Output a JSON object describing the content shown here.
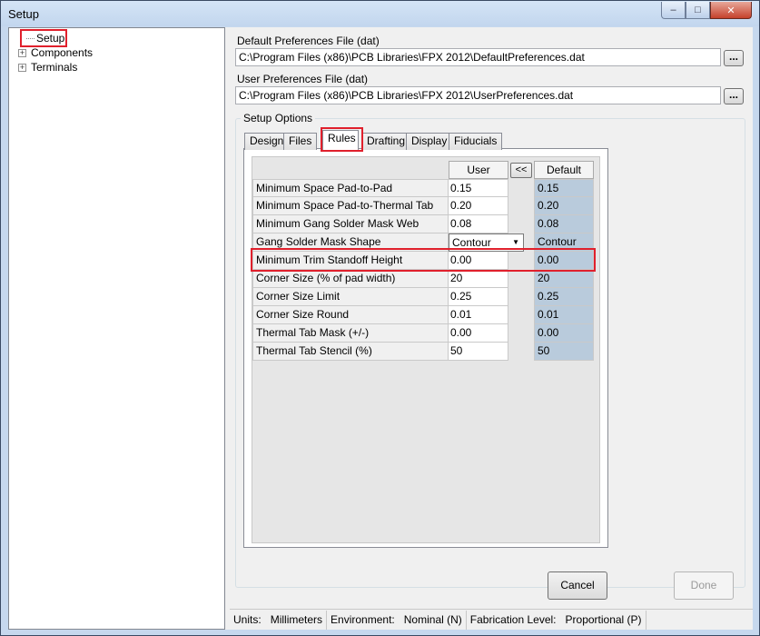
{
  "window": {
    "title": "Setup",
    "minimize": "–",
    "maximize": "□",
    "close": "✕"
  },
  "tree": {
    "items": [
      {
        "label": "Setup",
        "expander": ""
      },
      {
        "label": "Components",
        "expander": "+"
      },
      {
        "label": "Terminals",
        "expander": "+"
      }
    ]
  },
  "default_prefs": {
    "label": "Default Preferences File  (dat)",
    "value": "C:\\Program Files (x86)\\PCB Libraries\\FPX 2012\\DefaultPreferences.dat",
    "browse": "..."
  },
  "user_prefs": {
    "label": "User Preferences File  (dat)",
    "value": "C:\\Program Files (x86)\\PCB Libraries\\FPX 2012\\UserPreferences.dat",
    "browse": "..."
  },
  "setup_options": {
    "title": "Setup Options",
    "tabs": [
      "Design",
      "Files",
      "Rules",
      "Drafting",
      "Display",
      "Fiducials"
    ],
    "active_tab": "Rules"
  },
  "rules": {
    "header_user": "User",
    "header_default": "Default",
    "copy_button": "<<",
    "rows": [
      {
        "name": "Minimum Space Pad-to-Pad",
        "user": "0.15",
        "default": "0.15"
      },
      {
        "name": "Minimum Space Pad-to-Thermal Tab",
        "user": "0.20",
        "default": "0.20"
      },
      {
        "name": "Minimum Gang Solder Mask Web",
        "user": "0.08",
        "default": "0.08"
      },
      {
        "name": "Gang Solder Mask Shape",
        "user": "Contour",
        "default": "Contour"
      },
      {
        "name": "Minimum Trim Standoff Height",
        "user": "0.00",
        "default": "0.00"
      },
      {
        "name": "Corner Size (% of pad width)",
        "user": "20",
        "default": "20"
      },
      {
        "name": "Corner Size Limit",
        "user": "0.25",
        "default": "0.25"
      },
      {
        "name": "Corner Size Round",
        "user": "0.01",
        "default": "0.01"
      },
      {
        "name": "Thermal Tab Mask (+/-)",
        "user": "0.00",
        "default": "0.00"
      },
      {
        "name": "Thermal Tab Stencil (%)",
        "user": "50",
        "default": "50"
      }
    ]
  },
  "buttons": {
    "cancel": "Cancel",
    "done": "Done"
  },
  "status": {
    "units_label": "Units:",
    "units_value": "Millimeters",
    "env_label": "Environment:",
    "env_value": "Nominal (N)",
    "fab_label": "Fabrication Level:",
    "fab_value": "Proportional (P)"
  },
  "colors": {
    "highlight": "#e0202c",
    "default_cell": "#b9cbdc"
  }
}
